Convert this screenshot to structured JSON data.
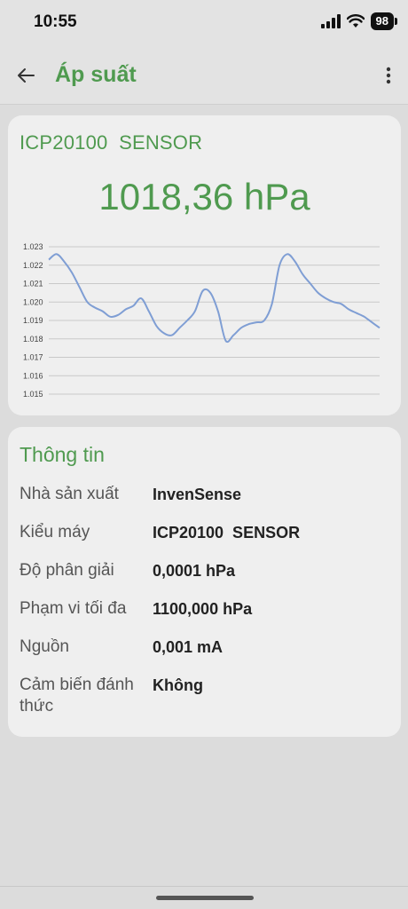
{
  "status_bar": {
    "time": "10:55",
    "battery": "98"
  },
  "app_bar": {
    "title": "Áp suất"
  },
  "sensor_card": {
    "name": "ICP20100  SENSOR",
    "value": "1018,36 hPa"
  },
  "chart_data": {
    "type": "line",
    "y_ticks": [
      "1.023",
      "1.022",
      "1.021",
      "1.020",
      "1.019",
      "1.018",
      "1.017",
      "1.016",
      "1.015"
    ],
    "ylim": [
      1.015,
      1.023
    ],
    "grid": true,
    "line_color": "#7f9ed4",
    "series": [
      {
        "values": [
          1.0223,
          1.0226,
          1.0222,
          1.0216,
          1.0208,
          1.02,
          1.0197,
          1.0195,
          1.0192,
          1.0193,
          1.0196,
          1.0198,
          1.0202,
          1.0195,
          1.0187,
          1.0183,
          1.0182,
          1.0186,
          1.019,
          1.0195,
          1.0206,
          1.0205,
          1.0195,
          1.0179,
          1.0182,
          1.0186,
          1.0188,
          1.0189,
          1.019,
          1.0199,
          1.022,
          1.0226,
          1.0222,
          1.0215,
          1.021,
          1.0205,
          1.0202,
          1.02,
          1.0199,
          1.0196,
          1.0194,
          1.0192,
          1.0189,
          1.0186
        ]
      }
    ]
  },
  "info_card": {
    "title": "Thông tin",
    "rows": [
      {
        "label": "Nhà sản xuất",
        "value": "InvenSense"
      },
      {
        "label": "Kiểu máy",
        "value": "ICP20100  SENSOR"
      },
      {
        "label": "Độ phân giải",
        "value": "0,0001 hPa"
      },
      {
        "label": "Phạm vi tối đa",
        "value": "1100,000 hPa"
      },
      {
        "label": "Nguồn",
        "value": "0,001 mA"
      },
      {
        "label": "Cảm biến đánh thức",
        "value": "Không"
      }
    ]
  }
}
